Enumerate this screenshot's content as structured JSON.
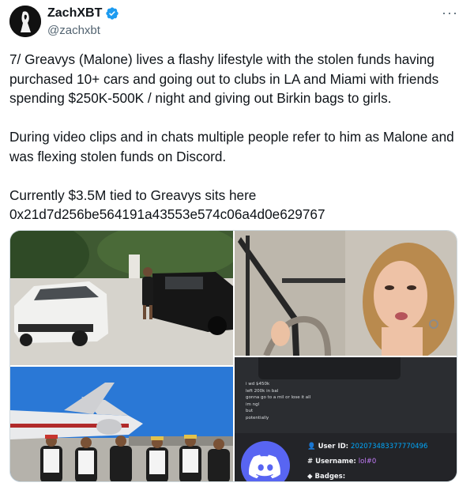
{
  "author": {
    "display_name": "ZachXBT",
    "handle": "@zachxbt",
    "more_label": "···"
  },
  "tweet": {
    "paragraphs": [
      "7/ Greavys (Malone) lives a flashy lifestyle with the stolen funds having purchased 10+ cars and going out to clubs in LA and Miami with friends spending $250K-500K / night and giving out Birkin bags to girls.",
      "During video clips and in chats multiple people refer to him as Malone and was flexing stolen funds on Discord.",
      "Currently $3.5M tied to Greavys sits here 0x21d7d256be564191a43553e574c06a4d0e629767"
    ]
  },
  "discord": {
    "chat_lines": [
      "i wd $450k",
      "left 200k in bal",
      "gonna go to a mil or lose it all",
      "im ngl",
      "but",
      "potentially"
    ],
    "user_id_label": "User ID:",
    "user_id": "202073483377770496",
    "username_label": "Username:",
    "username": "lol#0",
    "badges_label": "Badges:"
  },
  "colors": {
    "verified": "#1d9bf0",
    "discord_blurple": "#5865f2",
    "text": "#0f1419",
    "secondary": "#536471"
  }
}
